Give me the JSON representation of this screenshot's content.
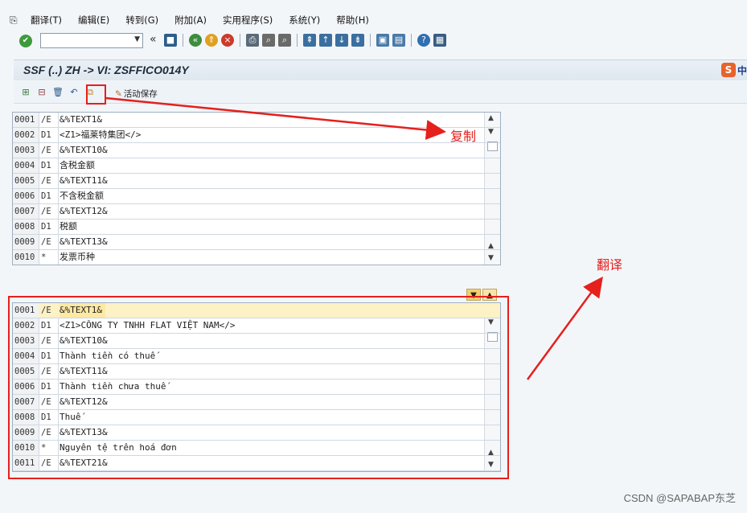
{
  "menu": {
    "items": [
      "翻译(T)",
      "编辑(E)",
      "转到(G)",
      "附加(A)",
      "实用程序(S)",
      "系统(Y)",
      "帮助(H)"
    ]
  },
  "toolbar": {
    "command_field_value": "",
    "double_arrow": "«"
  },
  "title": {
    "text": "SSF (..) ZH -> VI: ZSFFICO014Y",
    "ime_label": "中"
  },
  "app_toolbar": {
    "save_active_label": "活动保存"
  },
  "source_table": {
    "rows": [
      {
        "num": "0001",
        "fmt": "/E",
        "text": "&%TEXT1&"
      },
      {
        "num": "0002",
        "fmt": "D1",
        "text": "<Z1>福莱特集团</>"
      },
      {
        "num": "0003",
        "fmt": "/E",
        "text": "&%TEXT10&"
      },
      {
        "num": "0004",
        "fmt": "D1",
        "text": "含税金额"
      },
      {
        "num": "0005",
        "fmt": "/E",
        "text": "&%TEXT11&"
      },
      {
        "num": "0006",
        "fmt": "D1",
        "text": "不含税金额"
      },
      {
        "num": "0007",
        "fmt": "/E",
        "text": "&%TEXT12&"
      },
      {
        "num": "0008",
        "fmt": "D1",
        "text": "税额"
      },
      {
        "num": "0009",
        "fmt": "/E",
        "text": "&%TEXT13&"
      },
      {
        "num": "0010",
        "fmt": "*",
        "text": "发票币种"
      }
    ]
  },
  "target_table": {
    "rows": [
      {
        "num": "0001",
        "fmt": "/E",
        "text": "&%TEXT1&"
      },
      {
        "num": "0002",
        "fmt": "D1",
        "text": "<Z1>CÔNG TY TNHH FLAT VIỆT NAM</>"
      },
      {
        "num": "0003",
        "fmt": "/E",
        "text": "&%TEXT10&"
      },
      {
        "num": "0004",
        "fmt": "D1",
        "text": "Thành tiền có thuế"
      },
      {
        "num": "0005",
        "fmt": "/E",
        "text": "&%TEXT11&"
      },
      {
        "num": "0006",
        "fmt": "D1",
        "text": "Thành tiền chưa thuế"
      },
      {
        "num": "0007",
        "fmt": "/E",
        "text": "&%TEXT12&"
      },
      {
        "num": "0008",
        "fmt": "D1",
        "text": "Thuế"
      },
      {
        "num": "0009",
        "fmt": "/E",
        "text": "&%TEXT13&"
      },
      {
        "num": "0010",
        "fmt": "*",
        "text": "Nguyên tệ trên hoá đơn"
      },
      {
        "num": "0011",
        "fmt": "/E",
        "text": "&%TEXT21&"
      }
    ]
  },
  "annotations": {
    "copy_label": "复制",
    "translate_label": "翻译",
    "color": "#e5201d"
  },
  "watermark": "CSDN @SAPABAP东芝",
  "icons": {
    "ok": "check-circle-icon",
    "save": "save-icon",
    "copy": "copy-icon"
  }
}
